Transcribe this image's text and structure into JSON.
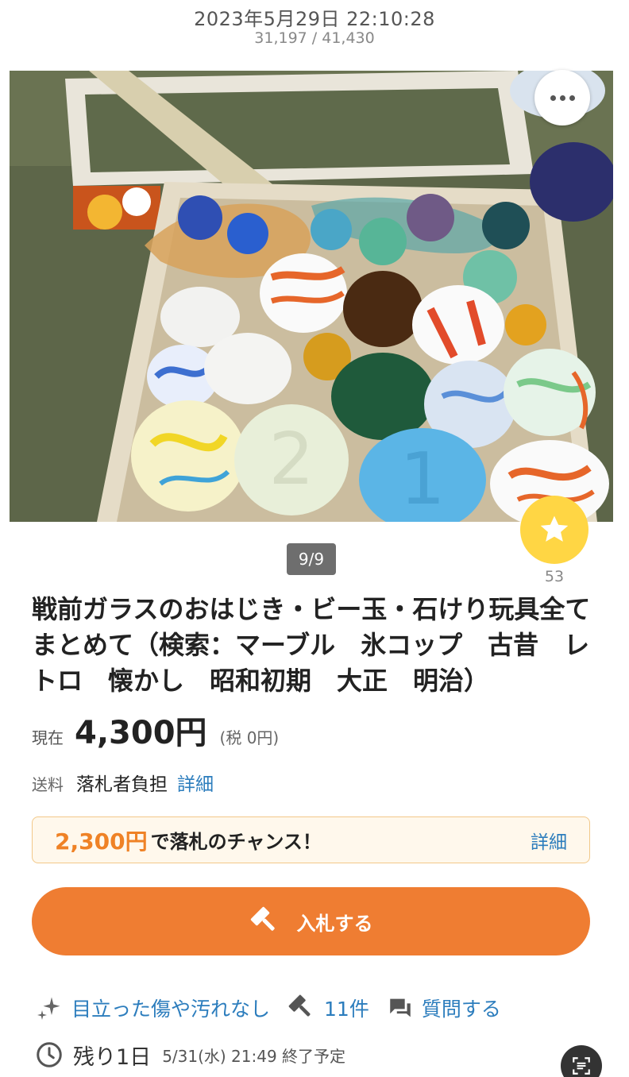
{
  "header": {
    "timestamp": "2023年5月29日 22:10:28",
    "counter": "31,197 / 41,430"
  },
  "gallery": {
    "page_indicator": "9/9",
    "watch_count": "53",
    "icons": {
      "more": "more-horizontal-icon",
      "watch": "star-icon"
    }
  },
  "item": {
    "title": "戦前ガラスのおはじき・ビー玉・石けり玩具全てまとめて（検索：マーブル　氷コップ　古昔　レトロ　懐かし　昭和初期　大正　明治）"
  },
  "price": {
    "label": "現在",
    "value": "4,300円",
    "tax": "(税 0円)"
  },
  "shipping": {
    "label": "送料",
    "value": "落札者負担",
    "link": "詳細"
  },
  "chance": {
    "price": "2,300円",
    "text": "で落札のチャンス！",
    "link": "詳細"
  },
  "bid_button": {
    "label": "入札する",
    "icon": "gavel-icon"
  },
  "meta": {
    "condition": "目立った傷や汚れなし",
    "bids": "11件",
    "question": "質問する",
    "icons": {
      "condition": "sparkle-icon",
      "bids": "gavel-icon",
      "question": "chat-icon"
    }
  },
  "time": {
    "remaining": "残り1日",
    "end": "5/31(水) 21:49 終了予定",
    "icon": "clock-icon"
  },
  "fab_icon": "scan-icon",
  "colors": {
    "accent": "#ef7d32",
    "link": "#2c7dbd",
    "star": "#ffd644",
    "chance_bg": "#fff8ec"
  }
}
